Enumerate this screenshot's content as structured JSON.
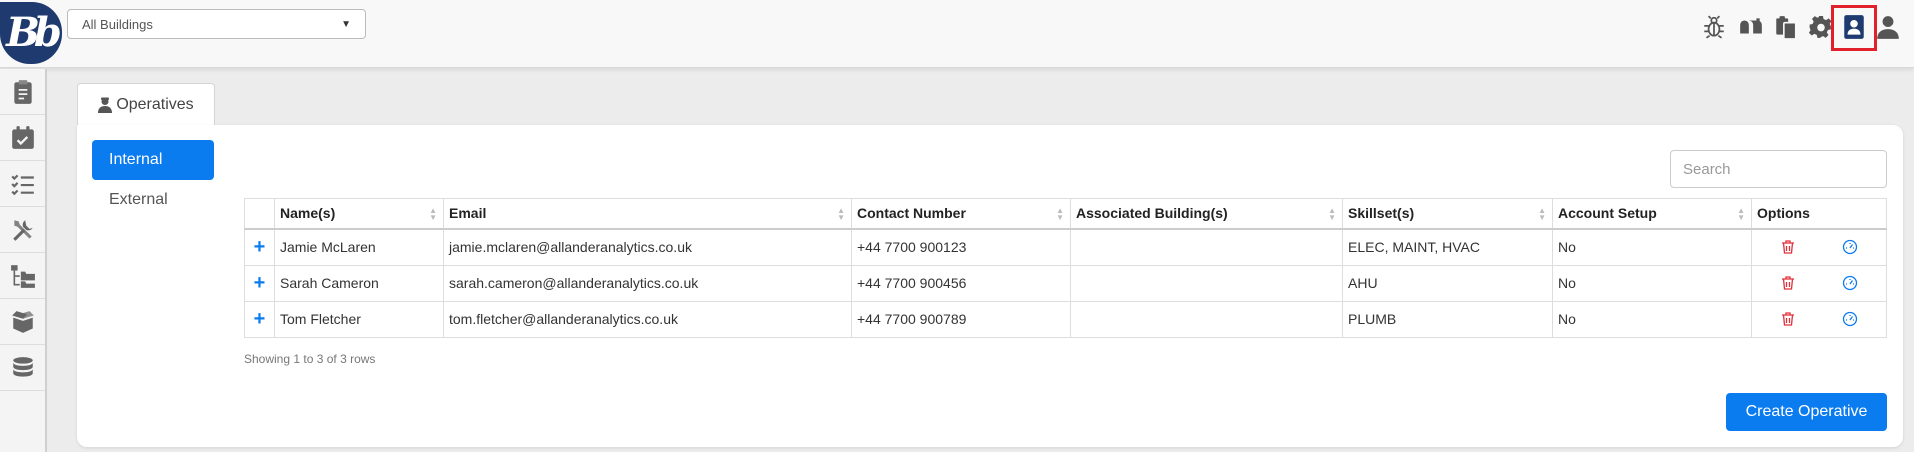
{
  "header": {
    "logo_text": "Bb",
    "building_select": {
      "selected": "All Buildings"
    }
  },
  "tab": {
    "label": "Operatives"
  },
  "pills": {
    "internal": "Internal",
    "external": "External"
  },
  "search": {
    "placeholder": "Search"
  },
  "table": {
    "headers": [
      "Name(s)",
      "Email",
      "Contact Number",
      "Associated Building(s)",
      "Skillset(s)",
      "Account Setup",
      "Options"
    ],
    "rows": [
      {
        "name": "Jamie McLaren",
        "email": "jamie.mclaren@allanderanalytics.co.uk",
        "phone": "+44 7700 900123",
        "buildings": "",
        "skills": "ELEC, MAINT, HVAC",
        "setup": "No"
      },
      {
        "name": "Sarah Cameron",
        "email": "sarah.cameron@allanderanalytics.co.uk",
        "phone": "+44 7700 900456",
        "buildings": "",
        "skills": "AHU",
        "setup": "No"
      },
      {
        "name": "Tom Fletcher",
        "email": "tom.fletcher@allanderanalytics.co.uk",
        "phone": "+44 7700 900789",
        "buildings": "",
        "skills": "PLUMB",
        "setup": "No"
      }
    ],
    "expand_symbol": "+"
  },
  "pagination": {
    "info": "Showing 1 to 3 of 3 rows"
  },
  "actions": {
    "create_label": "Create Operative"
  },
  "colors": {
    "primary": "#0b7bf0",
    "delete": "#e0303b",
    "highlight": "#e0202b",
    "logo": "#1e3a6e"
  },
  "icons": {
    "top": [
      "bug-icon",
      "mailbox-icon",
      "documents-icon",
      "gear-icon",
      "contact-card-icon",
      "user-icon"
    ],
    "sidebar": [
      "clipboard-icon",
      "calendar-check-icon",
      "task-list-icon",
      "tools-icon",
      "folder-tree-icon",
      "box-icon",
      "database-icon"
    ]
  }
}
